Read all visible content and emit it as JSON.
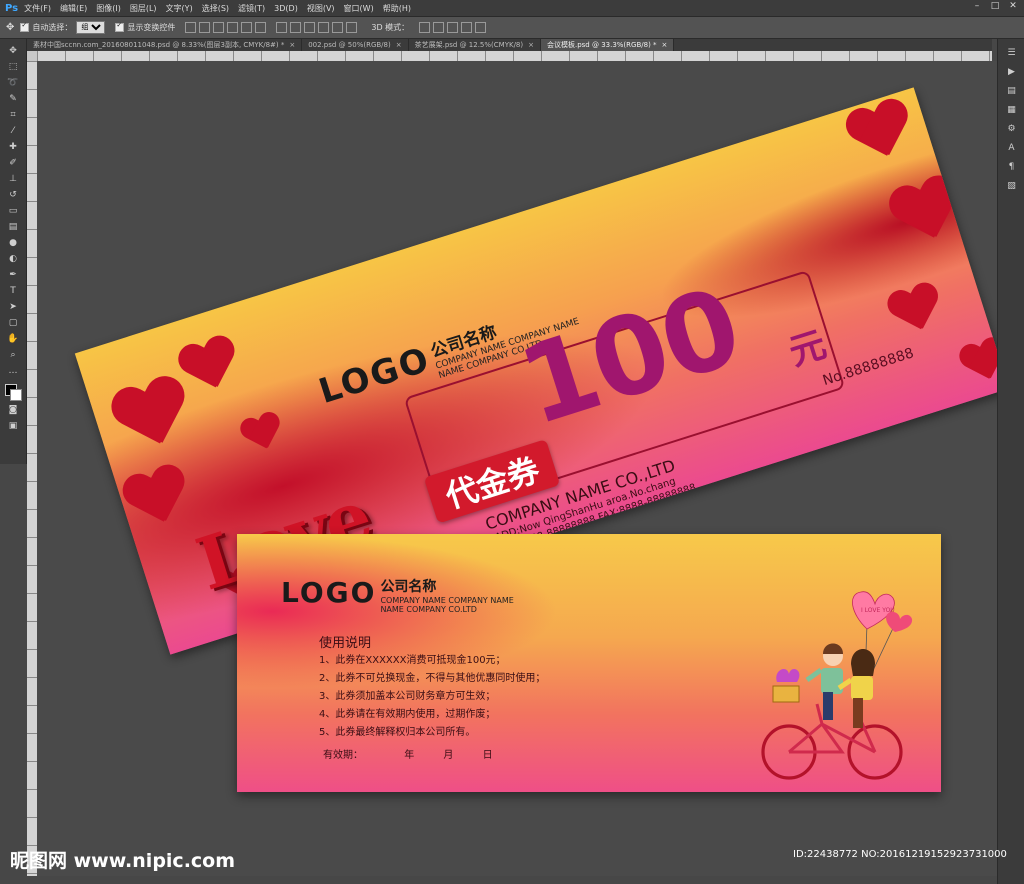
{
  "app": {
    "logo": "Ps"
  },
  "menu": [
    "文件(F)",
    "编辑(E)",
    "图像(I)",
    "图层(L)",
    "文字(Y)",
    "选择(S)",
    "滤镜(T)",
    "3D(D)",
    "视图(V)",
    "窗口(W)",
    "帮助(H)"
  ],
  "options": {
    "auto_select_label": "自动选择：",
    "auto_select_value": "组",
    "show_transform_label": "显示变换控件",
    "mode_3d_label": "3D 模式："
  },
  "tabs": [
    {
      "label": "素材中国sccnn.com_201608011048.psd @ 8.33%(图层3副本, CMYK/8#) *",
      "active": false
    },
    {
      "label": "002.psd @ 50%(RGB/8)",
      "active": false
    },
    {
      "label": "茶艺展架.psd @ 12.5%(CMYK/8)",
      "active": false
    },
    {
      "label": "会议模板.psd @ 33.3%(RGB/8) *",
      "active": true
    }
  ],
  "front": {
    "logo_text": "LOGO",
    "company_cn": "公司名称",
    "company_en_line1": "COMPANY NAME COMPANY NAME",
    "company_en_line2": "NAME COMPANY CO.LTD",
    "amount": "100",
    "currency": "元",
    "voucher_label": "代金券",
    "serial": "No.88888888",
    "company_name": "COMPANY NAME CO.,LTD",
    "address": "ADD:Now QingShanHu aroa.No.chang",
    "tel": "TEL:8888-88888888  FAX:8888-88888888",
    "love_text": "Love"
  },
  "back": {
    "logo_text": "LOGO",
    "company_cn": "公司名称",
    "company_en_line1": "COMPANY NAME COMPANY NAME",
    "company_en_line2": "NAME COMPANY CO.LTD",
    "instructions_title": "使用说明",
    "rules": [
      "1、此券在XXXXXX消费可抵现金100元；",
      "2、此券不可兑换现金，不得与其他优惠同时使用；",
      "3、此券须加盖本公司财务章方可生效；",
      "4、此券请在有效期内使用，过期作废；",
      "5、此券最终解释权归本公司所有。"
    ],
    "validity_label": "有效期：",
    "validity_year": "年",
    "validity_month": "月",
    "validity_day": "日",
    "balloon_text": "I LOVE YOU"
  },
  "watermark": {
    "left": "昵图网 www.nipic.com",
    "right": "ID:22438772 NO:20161219152923731000"
  }
}
